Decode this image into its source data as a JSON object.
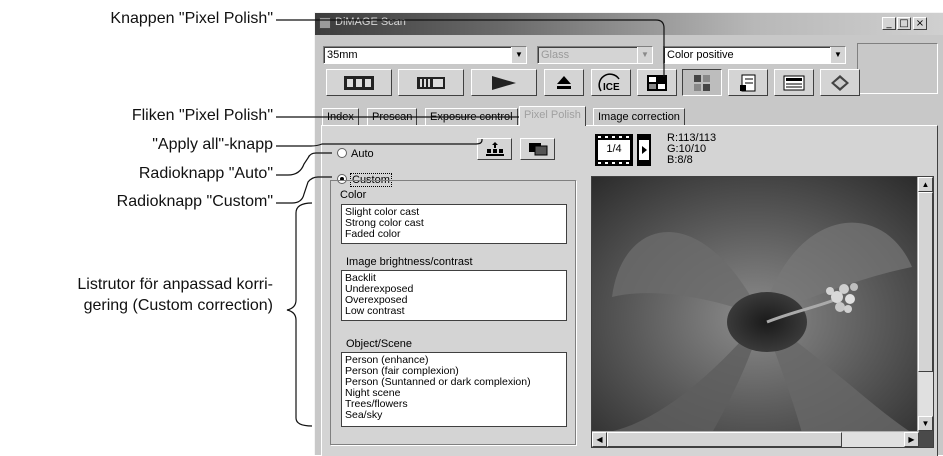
{
  "callouts": {
    "pixel_polish_button": "Knappen \"Pixel Polish\"",
    "pixel_polish_tab": "Fliken \"Pixel Polish\"",
    "apply_all_button": "\"Apply all\"-knapp",
    "radio_auto": "Radioknapp \"Auto\"",
    "radio_custom": "Radioknapp \"Custom\"",
    "custom_listboxes_line1": "Listrutor för anpassad korri-",
    "custom_listboxes_line2": "gering (Custom correction)"
  },
  "window": {
    "title": "DiMAGE Scan",
    "controls": {
      "minimize": "_",
      "maximize": "□",
      "close": "×"
    }
  },
  "toolbar": {
    "film_format": "35mm",
    "holder": "Glass",
    "film_type": "Color positive",
    "buttons": [
      "index-scan-icon",
      "prescan-icon",
      "scan-icon",
      "eject-icon",
      "ice-icon",
      "exposure-control-icon",
      "pixel-polish-icon",
      "preferences-icon",
      "job-icon",
      "help-icon"
    ],
    "ice_label": "ICE"
  },
  "tabs": [
    "Index",
    "Prescan",
    "Exposure control",
    "Pixel Polish",
    "Image correction"
  ],
  "active_tab": "Pixel Polish",
  "pixel_polish": {
    "auto_label": "Auto",
    "custom_label": "Custom",
    "selected": "Custom",
    "color_group": {
      "label": "Color",
      "items": [
        "Slight color cast",
        "Strong color cast",
        "Faded color"
      ]
    },
    "brightness_group": {
      "label": "Image brightness/contrast",
      "items": [
        "Backlit",
        "Underexposed",
        "Overexposed",
        "Low contrast"
      ]
    },
    "scene_group": {
      "label": "Object/Scene",
      "items": [
        "Person (enhance)",
        "Person (fair complexion)",
        "Person (Suntanned or dark complexion)",
        "Night scene",
        "Trees/flowers",
        "Sea/sky"
      ]
    }
  },
  "frame_indicator": "1/4",
  "rgb_readout": {
    "r": "R:113/113",
    "g": "G:10/10",
    "b": "B:8/8"
  }
}
